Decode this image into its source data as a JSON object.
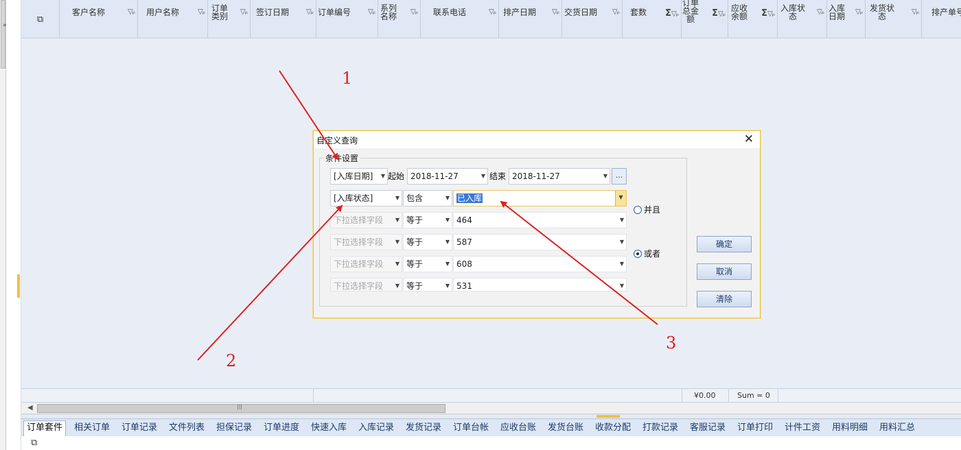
{
  "grid": {
    "header_icon": "column-chooser-icon",
    "columns": [
      {
        "label": "客户名称",
        "icon": "filter-pin-icon"
      },
      {
        "label": "用户名称",
        "icon": "filter-pin-icon"
      },
      {
        "label": "订单\n类别",
        "icon": "filter-pin-icon"
      },
      {
        "label": "签订日期",
        "icon": "filter-pin-icon"
      },
      {
        "label": "订单编号",
        "icon": "filter-pin-icon"
      },
      {
        "label": "系列\n名称",
        "icon": "filter-pin-icon"
      },
      {
        "label": "联系电话",
        "icon": "filter-pin-icon"
      },
      {
        "label": "排产日期",
        "icon": "filter-pin-icon"
      },
      {
        "label": "交货日期",
        "icon": "filter-pin-icon"
      },
      {
        "label": "套数",
        "icon": "sum-filter-pin-icon"
      },
      {
        "label": "订单\n总金\n额",
        "icon": "sum-filter-pin-icon"
      },
      {
        "label": "应收\n余额",
        "icon": "sum-filter-pin-icon"
      },
      {
        "label": "入库状\n态",
        "icon": "filter-pin-icon"
      },
      {
        "label": "入库\n日期",
        "icon": "filter-pin-icon"
      },
      {
        "label": "发货状\n态",
        "icon": "filter-pin-icon"
      },
      {
        "label": "排产单号",
        "icon": ""
      }
    ],
    "sum_symbol": "Σ",
    "filter_symbol": "▽ᵖ"
  },
  "footer": {
    "amount": "¥0.00",
    "sum": "Sum = 0"
  },
  "dialog": {
    "title": "自定义查询",
    "group_label": "条件设置",
    "row1": {
      "field": "[入库日期]",
      "start_label": "起始",
      "start": "2018-11-27",
      "end_label": "结束",
      "end": "2018-11-27",
      "more": "..."
    },
    "row2": {
      "field": "[入库状态]",
      "op": "包含",
      "value": "已入库"
    },
    "rows": [
      {
        "field": "下拉选择字段",
        "op": "等于",
        "value": "464"
      },
      {
        "field": "下拉选择字段",
        "op": "等于",
        "value": "587"
      },
      {
        "field": "下拉选择字段",
        "op": "等于",
        "value": "608"
      },
      {
        "field": "下拉选择字段",
        "op": "等于",
        "value": "531"
      }
    ],
    "radio_and": "并且",
    "radio_or": "或者",
    "ok": "确定",
    "cancel": "取消",
    "clear": "清除"
  },
  "tabs": [
    "订单套件",
    "相关订单",
    "订单记录",
    "文件列表",
    "担保记录",
    "订单进度",
    "快速入库",
    "入库记录",
    "发货记录",
    "订单台帐",
    "应收台账",
    "发货台账",
    "收款分配",
    "打款记录",
    "客服记录",
    "订单打印",
    "计件工资",
    "用料明细",
    "用料汇总"
  ],
  "annotations": {
    "n1": "1",
    "n2": "2",
    "n3": "3",
    "color": "#e02020"
  }
}
